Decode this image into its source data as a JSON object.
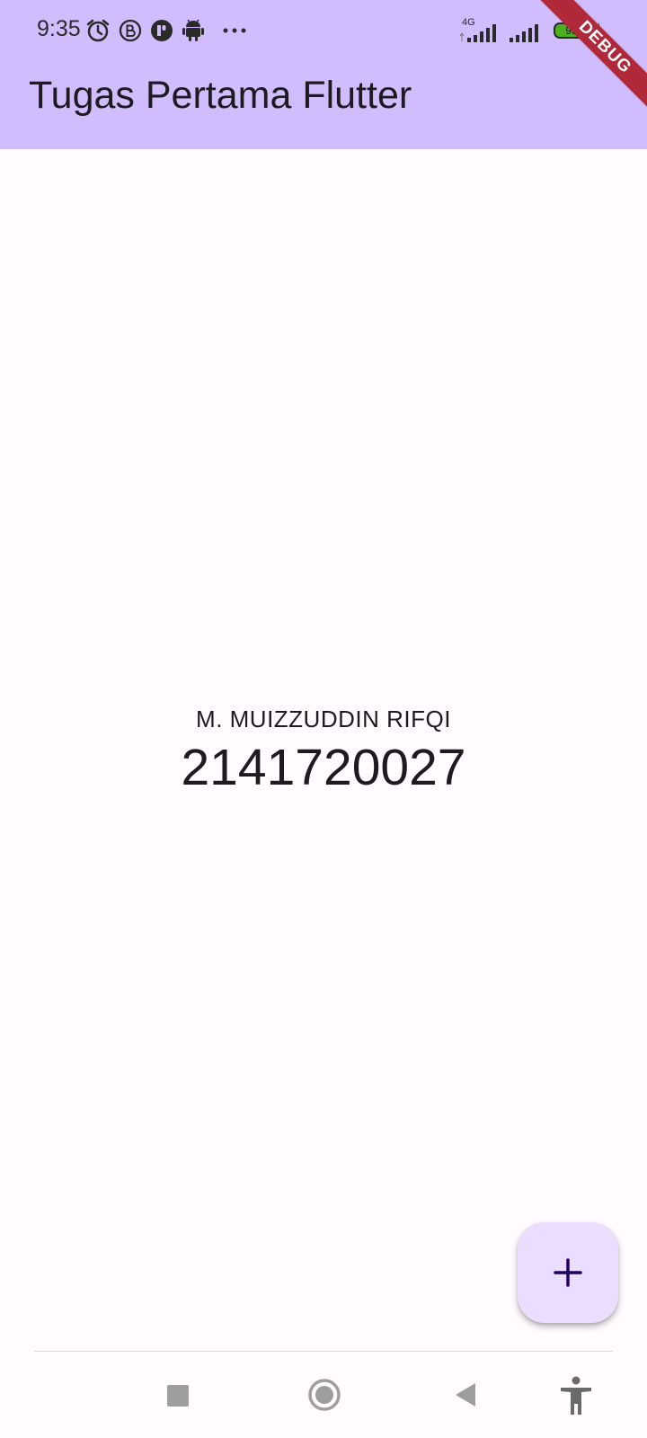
{
  "status_bar": {
    "time": "9:35",
    "network_label": "4G",
    "battery_level": "99",
    "icons": [
      "alarm-icon",
      "b-circle-icon",
      "p-badge-icon",
      "android-icon",
      "more-dots-icon",
      "signal-4g-icon",
      "signal-icon",
      "battery-icon",
      "charging-icon"
    ]
  },
  "app_bar": {
    "title": "Tugas Pertama Flutter",
    "debug_label": "DEBUG"
  },
  "content": {
    "name": "M. MUIZZUDDIN RIFQI",
    "nim": "2141720027"
  },
  "fab": {
    "icon": "plus-icon"
  },
  "nav_bar": {
    "icons": [
      "recent-apps-square-icon",
      "home-circle-icon",
      "back-triangle-icon",
      "accessibility-icon"
    ]
  },
  "colors": {
    "app_bar_bg": "#d1bcfd",
    "page_bg": "#fffbfe",
    "fab_bg": "#eaddff",
    "fab_icon": "#21005d",
    "debug_ribbon": "#b0293a"
  }
}
